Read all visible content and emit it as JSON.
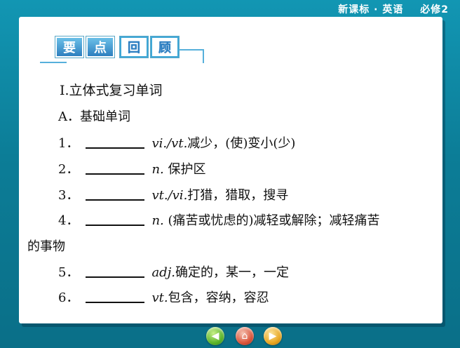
{
  "header": {
    "series": "新课标 · 英语",
    "book": "必修2"
  },
  "section_badge": {
    "chars": [
      "要",
      "点",
      "回",
      "顾"
    ]
  },
  "heading": "Ⅰ.立体式复习单词",
  "subheading": "A．基础单词",
  "items": [
    {
      "num": "1．",
      "pos": "vi./vt.",
      "meaning": "减少，(使)变小(少)"
    },
    {
      "num": "2．",
      "pos": "n.",
      "meaning": "保护区"
    },
    {
      "num": "3．",
      "pos": "vt./vi.",
      "meaning": "打猎，猎取，搜寻"
    },
    {
      "num": "4．",
      "pos": "n.",
      "meaning": "(痛苦或忧虑的)减轻或解除；减轻痛苦",
      "continuation": "的事物"
    },
    {
      "num": "5．",
      "pos": "adj.",
      "meaning": "确定的，某一，一定"
    },
    {
      "num": "6．",
      "pos": "vt.",
      "meaning": "包含，容纳，容忍"
    }
  ],
  "footer": {
    "buttons": [
      {
        "icon": "back-arrow-icon",
        "color": "#5bb42a"
      },
      {
        "icon": "home-icon",
        "color": "#d9543a"
      },
      {
        "icon": "forward-arrow-icon",
        "color": "#e8a621"
      }
    ]
  },
  "colors": {
    "frame": "#0c7d97",
    "badge": "#2d7fbf",
    "accent_line": "#56b0db"
  }
}
